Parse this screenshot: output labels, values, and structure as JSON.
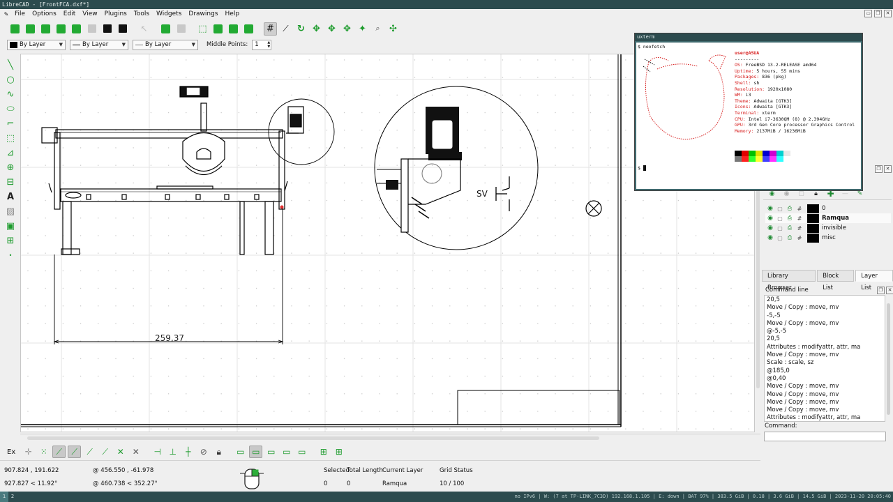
{
  "window": {
    "title": "LibreCAD - [FrontFCA.dxf*]"
  },
  "menu": [
    "File",
    "Options",
    "Edit",
    "View",
    "Plugins",
    "Tools",
    "Widgets",
    "Drawings",
    "Help"
  ],
  "pen": {
    "color": "By Layer",
    "width": "By Layer",
    "type": "By Layer",
    "middle_points_label": "Middle Points:",
    "middle_points_value": "1"
  },
  "drawing": {
    "dimension_text": "259,37",
    "symbol_text": "SV"
  },
  "snap_label": "Ex",
  "status": {
    "abs_coord": "907.824 , 191.622",
    "polar_coord": "927.827 < 11.92°",
    "rel_coord": "@  456.550 , -61.978",
    "rel_polar": "@  460.738 < 352.27°",
    "selected_label": "Selected",
    "selected_value": "0",
    "total_length_label": "Total Length",
    "total_length_value": "0",
    "current_layer_label": "Current Layer",
    "current_layer_value": "Ramqua",
    "grid_status_label": "Grid Status",
    "grid_status_value": "10 / 100"
  },
  "layers": [
    {
      "name": "0",
      "bold": false
    },
    {
      "name": "Ramqua",
      "bold": true
    },
    {
      "name": "invisible",
      "bold": false
    },
    {
      "name": "misc",
      "bold": false
    }
  ],
  "tabs": [
    "Library Browser",
    "Block List",
    "Layer List"
  ],
  "active_tab": "Layer List",
  "command_line": {
    "title": "Command line",
    "history": [
      "20,5",
      "Move / Copy : move, mv",
      "-5,-5",
      "Move / Copy : move, mv",
      "@-5,-5",
      "20,5",
      "Attributes : modifyattr, attr, ma",
      "Move / Copy : move, mv",
      "Scale : scale, sz",
      "@185,0",
      "@0,40",
      "Move / Copy : move, mv",
      "Move / Copy : move, mv",
      "Move / Copy : move, mv",
      "Move / Copy : move, mv",
      "Attributes : modifyattr, attr, ma"
    ],
    "input_label": "Command:"
  },
  "xterm": {
    "title": "uxterm",
    "command": "$ neofetch",
    "prompt": "$",
    "user": "user@ASUA",
    "separator": "---------",
    "info": [
      {
        "k": "OS:",
        "v": "FreeBSD 13.2-RELEASE amd64"
      },
      {
        "k": "Uptime:",
        "v": "5 hours, 55 mins"
      },
      {
        "k": "Packages:",
        "v": "836 (pkg)"
      },
      {
        "k": "Shell:",
        "v": "sh"
      },
      {
        "k": "Resolution:",
        "v": "1920x1080"
      },
      {
        "k": "WM:",
        "v": "i3"
      },
      {
        "k": "Theme:",
        "v": "Adwaita [GTK3]"
      },
      {
        "k": "Icons:",
        "v": "Adwaita [GTK3]"
      },
      {
        "k": "Terminal:",
        "v": "xterm"
      },
      {
        "k": "CPU:",
        "v": "Intel i7-3630QM (8) @ 2.394GHz"
      },
      {
        "k": "GPU:",
        "v": "3rd Gen Core processor Graphics Control"
      },
      {
        "k": "Memory:",
        "v": "2137MiB / 16236MiB"
      }
    ]
  },
  "taskbar": {
    "workspaces": [
      "1",
      "2"
    ],
    "info": "no IPv6 | W: (7 at TP-LINK_7C3D) 192.168.1.105 | E: down | BAT 97% | 383.5 GiB | 0.18 | 3.6 GiB | 14.5 GiB | 2023-11-20 20:05:40"
  },
  "colors": {
    "accent": "#1a9a2a",
    "titlebar": "#2c4b4e",
    "terminal_red": "#d61a1a"
  }
}
